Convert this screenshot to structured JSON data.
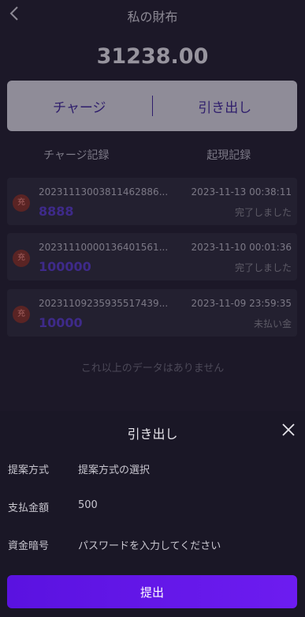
{
  "header": {
    "title": "私の財布",
    "back_icon": "chevron-left-icon"
  },
  "balance": "31238.00",
  "actions": {
    "charge_label": "チャージ",
    "withdraw_label": "引き出し"
  },
  "tabs": [
    "チャージ記録",
    "起現記録"
  ],
  "records": [
    {
      "badge": "充",
      "id": "20231113003811462886...",
      "amount": "8888",
      "time": "2023-11-13 00:38:11",
      "status": "完了しました"
    },
    {
      "badge": "充",
      "id": "20231110000136401561...",
      "amount": "100000",
      "time": "2023-11-10 00:01:36",
      "status": "完了しました"
    },
    {
      "badge": "充",
      "id": "20231109235935517439...",
      "amount": "10000",
      "time": "2023-11-09 23:59:35",
      "status": "未払い金"
    }
  ],
  "no_more": "これ以上のデータはありません",
  "sheet": {
    "title": "引き出し",
    "close_icon": "close-icon",
    "method_label": "提案方式",
    "method_value": "提案方式の選択",
    "amount_label": "支払金額",
    "amount_value": "500",
    "password_label": "資金暗号",
    "password_placeholder": "パスワードを入力してください",
    "submit_label": "提出"
  },
  "colors": {
    "accent": "#6a1af0",
    "badge": "#5a2424"
  }
}
